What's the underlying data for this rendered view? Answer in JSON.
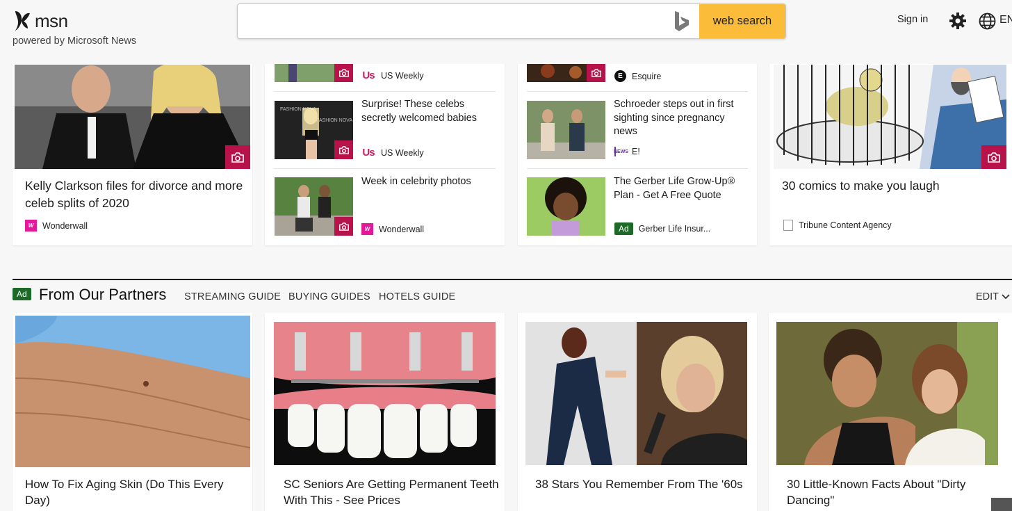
{
  "header": {
    "logo_text": "msn",
    "powered_by": "powered by Microsoft News",
    "search_placeholder": "",
    "search_button": "web search",
    "sign_in": "Sign in",
    "language": "EN"
  },
  "icons": {
    "logo": "msn-butterfly-icon",
    "bing": "bing-icon",
    "settings": "gear-icon",
    "language": "globe-icon",
    "gallery": "camera-icon"
  },
  "colors": {
    "search_button": "#fbbc3a",
    "gallery_badge": "#b8124a",
    "ad_badge": "#1d6a28",
    "wonderwall": "#e6189a",
    "us_weekly": "#d01a63"
  },
  "top_cards": {
    "kelly": {
      "title": "Kelly Clarkson files for divorce and more celeb splits of 2020",
      "source": "Wonderwall"
    },
    "col2": [
      {
        "title": "",
        "source": "US Weekly"
      },
      {
        "title": "Surprise! These celebs secretly welcomed babies",
        "source": "US Weekly"
      },
      {
        "title": "Week in celebrity photos",
        "source": "Wonderwall"
      }
    ],
    "col3": [
      {
        "title": "",
        "source": "Esquire"
      },
      {
        "title": "Schroeder steps out in first sighting since pregnancy news",
        "source": "E!"
      },
      {
        "title": "The Gerber Life Grow-Up® Plan - Get A Free Quote",
        "source": "Gerber Life Insur...",
        "ad_label": "Ad"
      }
    ],
    "comics": {
      "title": "30 comics to make you laugh",
      "source": "Tribune Content Agency"
    }
  },
  "partners": {
    "ad_label": "Ad",
    "title": "From Our Partners",
    "tabs": [
      "STREAMING GUIDE",
      "BUYING GUIDES",
      "HOTELS GUIDE"
    ],
    "edit": "EDIT",
    "cards": [
      {
        "title": "How To Fix Aging Skin (Do This Every Day)"
      },
      {
        "title": "SC Seniors Are Getting Permanent Teeth With This - See Prices"
      },
      {
        "title": "38 Stars You Remember From The '60s"
      },
      {
        "title": "30 Little-Known Facts About \"Dirty Dancing\""
      }
    ]
  }
}
